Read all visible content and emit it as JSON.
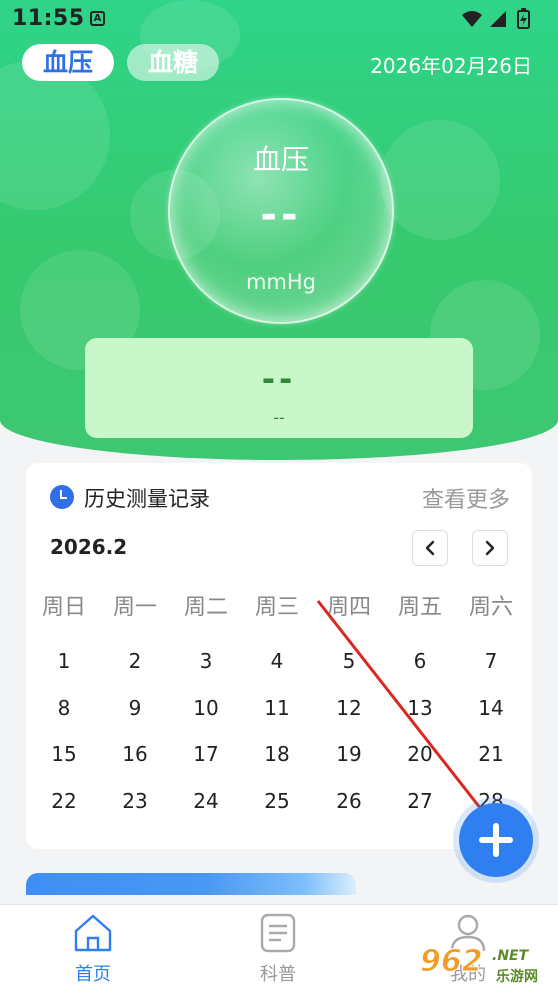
{
  "status_bar": {
    "time": "11:55",
    "app_badge": "A"
  },
  "tabs": [
    {
      "label": "血压",
      "active": true
    },
    {
      "label": "血糖",
      "active": false
    }
  ],
  "header": {
    "date": "2026年02月26日"
  },
  "bubble": {
    "title": "血压",
    "value": "--",
    "unit": "mmHg"
  },
  "result": {
    "main": "--",
    "sub": "--"
  },
  "history": {
    "title": "历史测量记录",
    "more": "查看更多",
    "month": "2026.2",
    "weekdays": [
      "周日",
      "周一",
      "周二",
      "周三",
      "周四",
      "周五",
      "周六"
    ],
    "rows": [
      [
        "1",
        "2",
        "3",
        "4",
        "5",
        "6",
        "7"
      ],
      [
        "8",
        "9",
        "10",
        "11",
        "12",
        "13",
        "14"
      ],
      [
        "15",
        "16",
        "17",
        "18",
        "19",
        "20",
        "21"
      ],
      [
        "22",
        "23",
        "24",
        "25",
        "26",
        "27",
        "28"
      ]
    ]
  },
  "bottom_nav": [
    {
      "label": "首页",
      "icon": "home-icon",
      "active": true
    },
    {
      "label": "科普",
      "icon": "document-icon",
      "active": false
    },
    {
      "label": "我的",
      "icon": "user-icon",
      "active": false
    }
  ],
  "watermark": {
    "number": "962",
    "net": ".NET",
    "site": "乐游网"
  },
  "colors": {
    "accent": "#2f7ff0",
    "header_green": "#36c96d",
    "result_bg": "#c9f7ca",
    "annotation_arrow": "#d9281f"
  }
}
